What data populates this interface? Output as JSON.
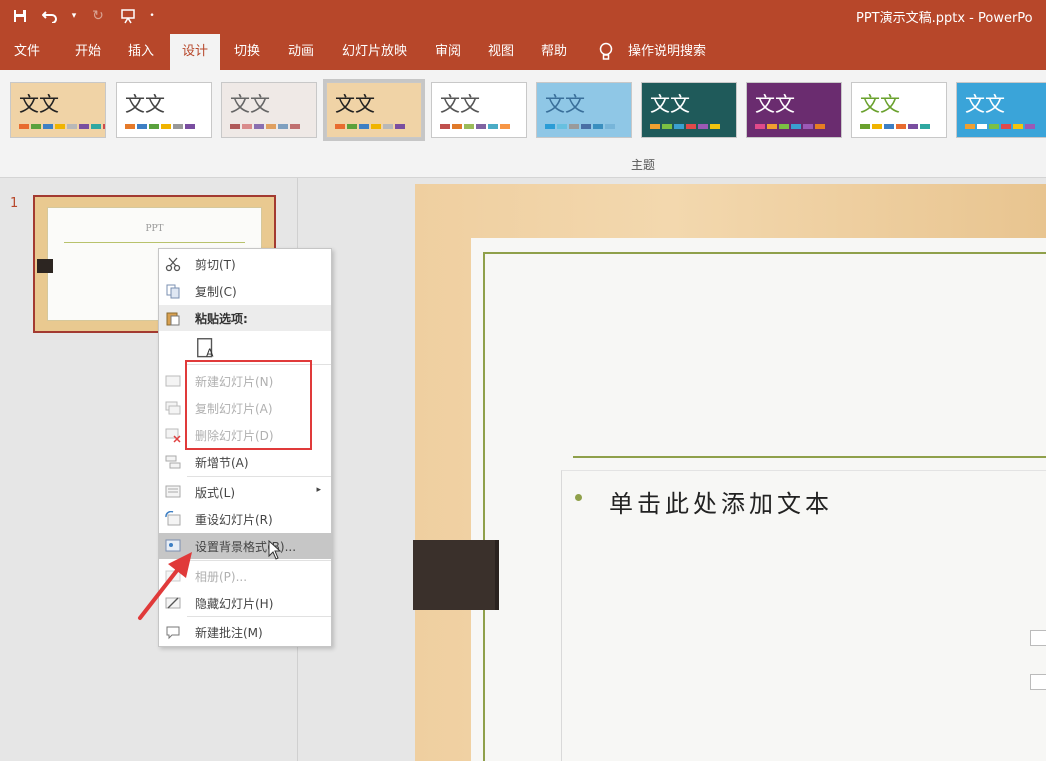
{
  "titlebar": {
    "doc_title": "PPT演示文稿.pptx - PowerPo"
  },
  "tabs": [
    {
      "label": "文件"
    },
    {
      "label": "开始"
    },
    {
      "label": "插入"
    },
    {
      "label": "设计",
      "active": true
    },
    {
      "label": "切换"
    },
    {
      "label": "动画"
    },
    {
      "label": "幻灯片放映"
    },
    {
      "label": "审阅"
    },
    {
      "label": "视图"
    },
    {
      "label": "帮助"
    },
    {
      "label": "操作说明搜索"
    }
  ],
  "ribbon": {
    "group_label": "主题",
    "themes": [
      {
        "label": "文文",
        "bg": "#f0d3a6",
        "fg": "#222",
        "selected": false
      },
      {
        "label": "文文",
        "bg": "#ffffff",
        "fg": "#444",
        "selected": false
      },
      {
        "label": "文文",
        "bg": "#efe9e6",
        "fg": "#666",
        "selected": false
      },
      {
        "label": "文文",
        "bg": "#f0d3a6",
        "fg": "#222",
        "selected": true
      },
      {
        "label": "文文",
        "bg": "#ffffff",
        "fg": "#555",
        "selected": false
      },
      {
        "label": "文文",
        "bg": "#8fc7e6",
        "fg": "#3a6f9a",
        "selected": false
      },
      {
        "label": "文文",
        "bg": "#1f5a5a",
        "fg": "#ffffff",
        "selected": false
      },
      {
        "label": "文文",
        "bg": "#6a2c6f",
        "fg": "#ffffff",
        "selected": false
      },
      {
        "label": "文文",
        "bg": "#ffffff",
        "fg": "#6aa12e",
        "selected": false
      },
      {
        "label": "文文",
        "bg": "#3aa4d9",
        "fg": "#ffffff",
        "selected": false
      }
    ]
  },
  "thumbnails": {
    "slide_number": "1",
    "thumb_title": "PPT"
  },
  "slide": {
    "content_placeholder": "单击此处添加文本"
  },
  "context_menu": {
    "items": [
      {
        "label": "剪切(T)",
        "icon": "scissors-icon"
      },
      {
        "label": "复制(C)",
        "icon": "copy-icon"
      },
      {
        "label": "粘贴选项:",
        "icon": "paste-icon",
        "header": true
      },
      {
        "label": "",
        "icon": "paste-keep-text-icon"
      },
      {
        "label": "新建幻灯片(N)",
        "icon": "new-slide-icon",
        "disabled": true
      },
      {
        "label": "复制幻灯片(A)",
        "icon": "duplicate-slide-icon",
        "disabled": true
      },
      {
        "label": "删除幻灯片(D)",
        "icon": "delete-slide-icon",
        "disabled": true
      },
      {
        "label": "新增节(A)",
        "icon": "add-section-icon"
      },
      {
        "label": "版式(L)",
        "icon": "layout-icon",
        "submenu": true
      },
      {
        "label": "重设幻灯片(R)",
        "icon": "reset-slide-icon"
      },
      {
        "label": "设置背景格式(B)...",
        "icon": "format-background-icon",
        "hover": true
      },
      {
        "label": "相册(P)...",
        "icon": "photo-album-icon",
        "disabled": true
      },
      {
        "label": "隐藏幻灯片(H)",
        "icon": "hide-slide-icon"
      },
      {
        "label": "新建批注(M)",
        "icon": "new-comment-icon"
      }
    ]
  },
  "colors": {
    "accent": "#b7472a",
    "highlight": "#e03a3a",
    "slide_line": "#8fa04a"
  }
}
